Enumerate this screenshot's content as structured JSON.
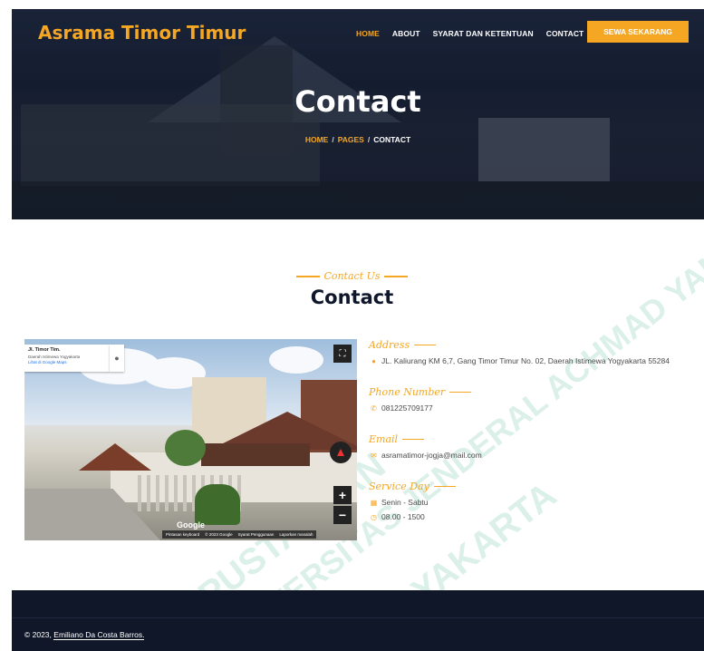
{
  "brand": "Asrama Timor Timur",
  "nav": {
    "items": [
      "HOME",
      "ABOUT",
      "SYARAT DAN KETENTUAN",
      "CONTACT"
    ],
    "active": "HOME",
    "cta": "SEWA SEKARANG"
  },
  "hero": {
    "title": "Contact",
    "breadcrumb": [
      "HOME",
      "PAGES",
      "CONTACT"
    ]
  },
  "section": {
    "subtitle": "Contact Us",
    "title": "Contact"
  },
  "map": {
    "place_name": "Jl. Timor Tim.",
    "region": "Daerah Istimewa Yogyakarta",
    "link": "Lihat di Google Maps",
    "google_label": "Google",
    "footer": [
      "Pintasan keyboard",
      "© 2023 Google",
      "Syarat Penggunaan",
      "Laporkan masalah"
    ]
  },
  "contact": {
    "address_label": "Address",
    "address": "JL. Kaliurang KM 6,7, Gang Timor Timur No. 02, Daerah Istimewa Yogyakarta 55284",
    "phone_label": "Phone Number",
    "phone": "081225709177",
    "email_label": "Email",
    "email": "asramatimor-jogja@mail.com",
    "service_label": "Service Day",
    "days": "Senin - Sabtu",
    "hours": "08.00 - 1500"
  },
  "watermark": [
    "PERPUSTAKAAN",
    "UNIVERSITAS JENDERAL ACHMAD YANI",
    "YOGYAKARTA"
  ],
  "footer": {
    "copyright_prefix": "© 2023,",
    "copyright_name": "Emiliano Da Costa Barros."
  },
  "colors": {
    "accent": "#f5a623",
    "dark": "#0f1729",
    "text": "#4a4a4a"
  }
}
